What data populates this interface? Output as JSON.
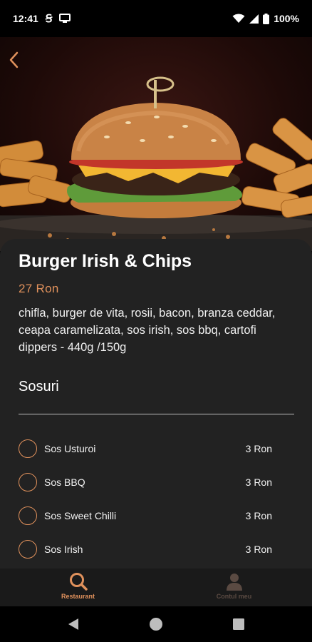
{
  "status_bar": {
    "time": "12:41",
    "battery_percent": "100%",
    "icons": [
      "s-app-icon",
      "screen-cast-icon",
      "wifi-icon",
      "cell-signal-icon",
      "battery-icon"
    ]
  },
  "product": {
    "title": "Burger Irish & Chips",
    "price": "27 Ron",
    "description": "chifla, burger de vita, rosii, bacon, branza ceddar, ceapa caramelizata, sos irish, sos bbq, cartofi dippers - 440g /150g"
  },
  "sauces": {
    "section_title": "Sosuri",
    "items": [
      {
        "name": "Sos Usturoi",
        "price": "3 Ron"
      },
      {
        "name": "Sos BBQ",
        "price": "3 Ron"
      },
      {
        "name": "Sos Sweet Chilli",
        "price": "3 Ron"
      },
      {
        "name": "Sos Irish",
        "price": "3 Ron"
      }
    ]
  },
  "bottom_nav": {
    "items": [
      {
        "label": "Restaurant",
        "icon": "search-icon",
        "active": true
      },
      {
        "label": "Contul meu",
        "icon": "user-icon",
        "active": false
      }
    ]
  },
  "colors": {
    "accent": "#e0915c",
    "card_background": "#222222",
    "nav_background": "#1a1a1a",
    "inactive": "#5a4a42"
  }
}
